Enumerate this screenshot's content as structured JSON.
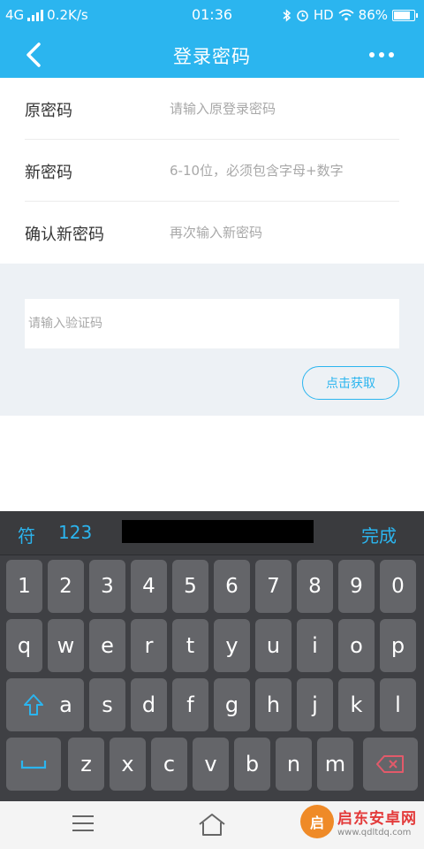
{
  "status_bar": {
    "network": "4G",
    "speed": "0.2K/s",
    "time": "01:36",
    "hd": "HD",
    "battery": "86%",
    "battery_level": 0.86
  },
  "header": {
    "title": "登录密码",
    "color": "#2bb5ef"
  },
  "form": {
    "rows": [
      {
        "label": "原密码",
        "placeholder": "请输入原登录密码"
      },
      {
        "label": "新密码",
        "placeholder": "6-10位，必须包含字母+数字"
      },
      {
        "label": "确认新密码",
        "placeholder": "再次输入新密码"
      }
    ],
    "code_placeholder": "请输入验证码",
    "get_code_label": "点击获取"
  },
  "keyboard": {
    "toolbar": {
      "symbols": "符",
      "numbers": "123",
      "done": "完成"
    },
    "rows": [
      [
        "1",
        "2",
        "3",
        "4",
        "5",
        "6",
        "7",
        "8",
        "9",
        "0"
      ],
      [
        "q",
        "w",
        "e",
        "r",
        "t",
        "y",
        "u",
        "i",
        "o",
        "p"
      ],
      [
        "a",
        "s",
        "d",
        "f",
        "g",
        "h",
        "j",
        "k",
        "l"
      ],
      [
        "z",
        "x",
        "c",
        "v",
        "b",
        "n",
        "m"
      ]
    ]
  },
  "watermark": {
    "logo_text": "启",
    "title": "启东安卓网",
    "url": "www.qdltdq.com"
  }
}
